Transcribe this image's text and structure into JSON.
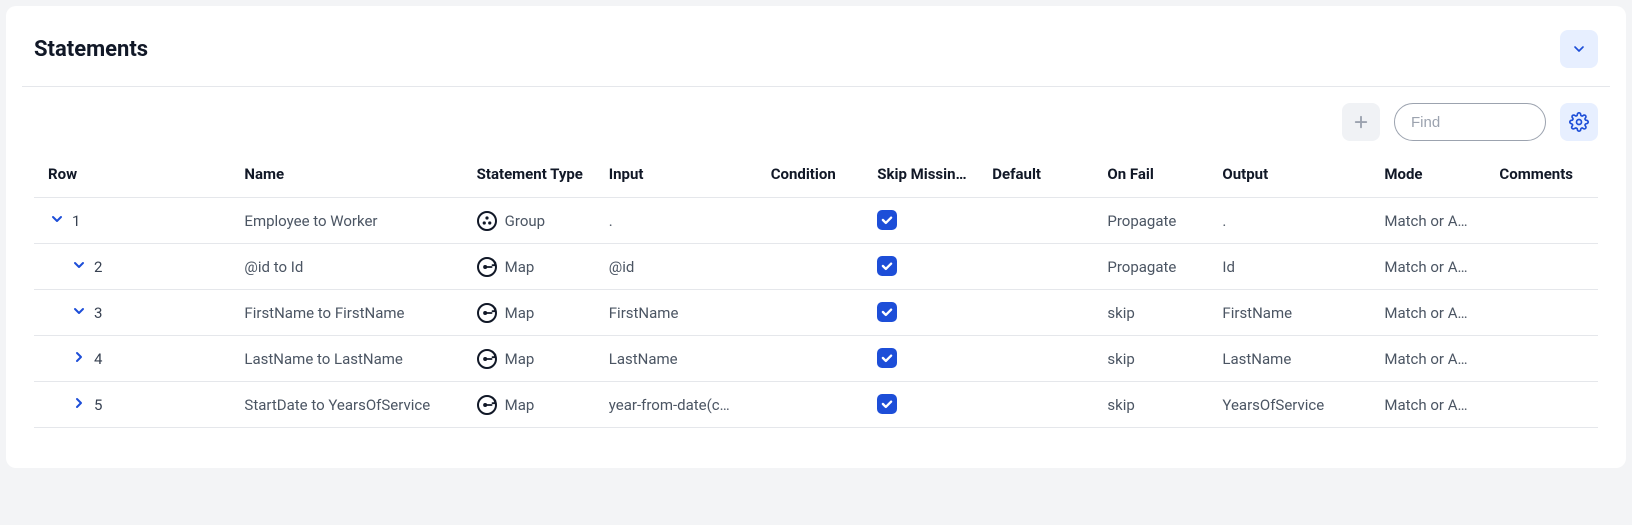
{
  "panel": {
    "title": "Statements"
  },
  "toolbar": {
    "find_placeholder": "Find"
  },
  "columns": {
    "row": "Row",
    "name": "Name",
    "stype": "Statement Type",
    "input": "Input",
    "condition": "Condition",
    "skip": "Skip Missin…",
    "default": "Default",
    "onfail": "On Fail",
    "output": "Output",
    "mode": "Mode",
    "comments": "Comments"
  },
  "rows": [
    {
      "num": "1",
      "indent": 1,
      "expanded": true,
      "name": "Employee to Worker",
      "stype": "Group",
      "sicon": "group",
      "input": ".",
      "condition": "",
      "skip": true,
      "default": "",
      "onfail": "Propagate",
      "output": ".",
      "mode": "Match or A…",
      "comments": ""
    },
    {
      "num": "2",
      "indent": 2,
      "expanded": true,
      "name": "@id to Id",
      "stype": "Map",
      "sicon": "map",
      "input": "@id",
      "condition": "",
      "skip": true,
      "default": "",
      "onfail": "Propagate",
      "output": "Id",
      "mode": "Match or A…",
      "comments": ""
    },
    {
      "num": "3",
      "indent": 2,
      "expanded": true,
      "name": "FirstName to FirstName",
      "stype": "Map",
      "sicon": "map",
      "input": "FirstName",
      "condition": "",
      "skip": true,
      "default": "",
      "onfail": "skip",
      "output": "FirstName",
      "mode": "Match or A…",
      "comments": ""
    },
    {
      "num": "4",
      "indent": 2,
      "expanded": false,
      "name": "LastName to LastName",
      "stype": "Map",
      "sicon": "map",
      "input": "LastName",
      "condition": "",
      "skip": true,
      "default": "",
      "onfail": "skip",
      "output": "LastName",
      "mode": "Match or A…",
      "comments": ""
    },
    {
      "num": "5",
      "indent": 2,
      "expanded": false,
      "name": "StartDate to YearsOfService",
      "stype": "Map",
      "sicon": "map",
      "input": "year-from-date(c…",
      "condition": "",
      "skip": true,
      "default": "",
      "onfail": "skip",
      "output": "YearsOfService",
      "mode": "Match or A…",
      "comments": ""
    }
  ]
}
